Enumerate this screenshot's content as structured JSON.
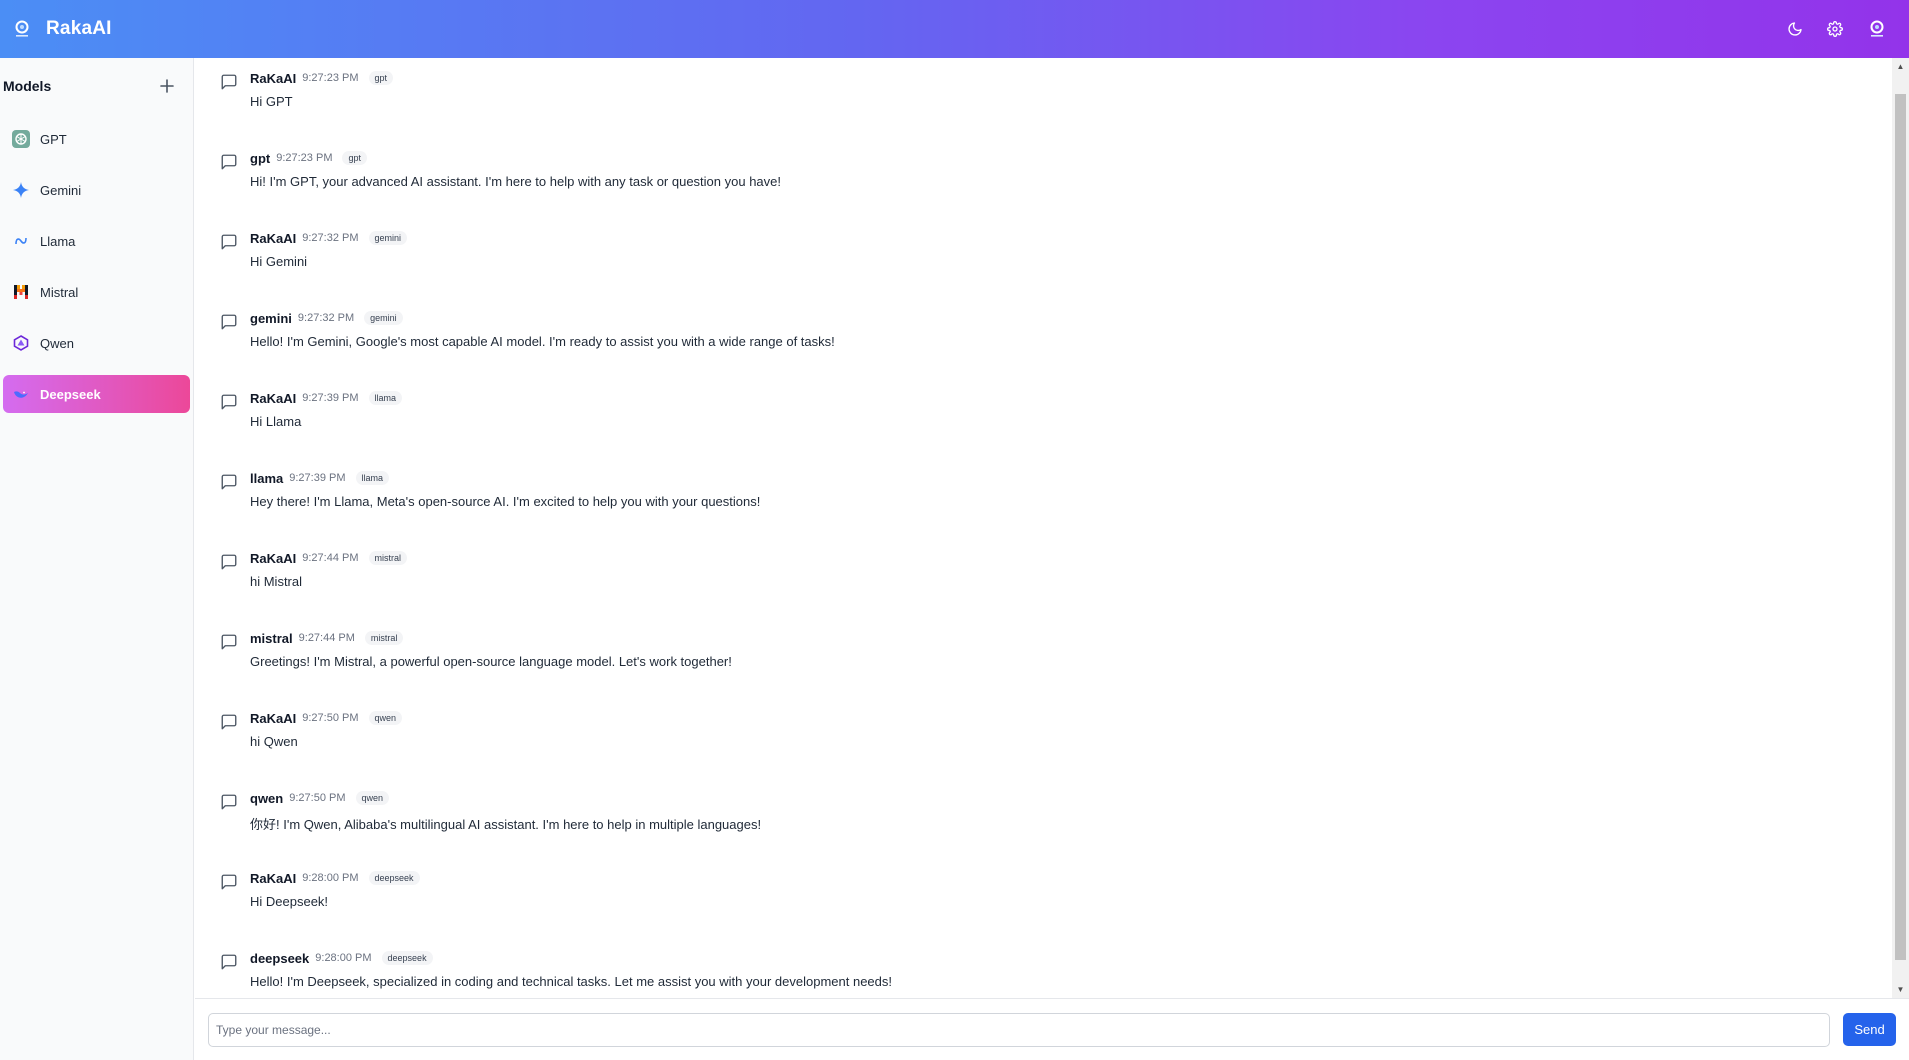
{
  "header": {
    "brand": "RakaAI"
  },
  "sidebar": {
    "title": "Models",
    "items": [
      {
        "label": "GPT",
        "icon": "openai-icon"
      },
      {
        "label": "Gemini",
        "icon": "gemini-sparkle-icon"
      },
      {
        "label": "Llama",
        "icon": "meta-llama-icon"
      },
      {
        "label": "Mistral",
        "icon": "mistral-icon"
      },
      {
        "label": "Qwen",
        "icon": "qwen-icon"
      },
      {
        "label": "Deepseek",
        "icon": "deepseek-icon",
        "active": true
      }
    ]
  },
  "messages": [
    {
      "author": "RaKaAI",
      "time": "9:27:23 PM",
      "tag": "gpt",
      "text": "Hi GPT"
    },
    {
      "author": "gpt",
      "time": "9:27:23 PM",
      "tag": "gpt",
      "text": "Hi! I'm GPT, your advanced AI assistant. I'm here to help with any task or question you have!"
    },
    {
      "author": "RaKaAI",
      "time": "9:27:32 PM",
      "tag": "gemini",
      "text": "Hi Gemini"
    },
    {
      "author": "gemini",
      "time": "9:27:32 PM",
      "tag": "gemini",
      "text": "Hello! I'm Gemini, Google's most capable AI model. I'm ready to assist you with a wide range of tasks!"
    },
    {
      "author": "RaKaAI",
      "time": "9:27:39 PM",
      "tag": "llama",
      "text": "Hi Llama"
    },
    {
      "author": "llama",
      "time": "9:27:39 PM",
      "tag": "llama",
      "text": "Hey there! I'm Llama, Meta's open-source AI. I'm excited to help you with your questions!"
    },
    {
      "author": "RaKaAI",
      "time": "9:27:44 PM",
      "tag": "mistral",
      "text": "hi Mistral"
    },
    {
      "author": "mistral",
      "time": "9:27:44 PM",
      "tag": "mistral",
      "text": "Greetings! I'm Mistral, a powerful open-source language model. Let's work together!"
    },
    {
      "author": "RaKaAI",
      "time": "9:27:50 PM",
      "tag": "qwen",
      "text": "hi Qwen"
    },
    {
      "author": "qwen",
      "time": "9:27:50 PM",
      "tag": "qwen",
      "text": "你好! I'm Qwen, Alibaba's multilingual AI assistant. I'm here to help in multiple languages!"
    },
    {
      "author": "RaKaAI",
      "time": "9:28:00 PM",
      "tag": "deepseek",
      "text": "Hi Deepseek!"
    },
    {
      "author": "deepseek",
      "time": "9:28:00 PM",
      "tag": "deepseek",
      "text": "Hello! I'm Deepseek, specialized in coding and technical tasks. Let me assist you with your development needs!"
    }
  ],
  "composer": {
    "placeholder": "Type your message...",
    "value": "",
    "send_label": "Send"
  },
  "colors": {
    "header_gradient_start": "#4b8ef5",
    "header_gradient_end": "#9333ea",
    "active_item_start": "#d46cf0",
    "active_item_end": "#ec4899",
    "send_button": "#2563eb"
  }
}
